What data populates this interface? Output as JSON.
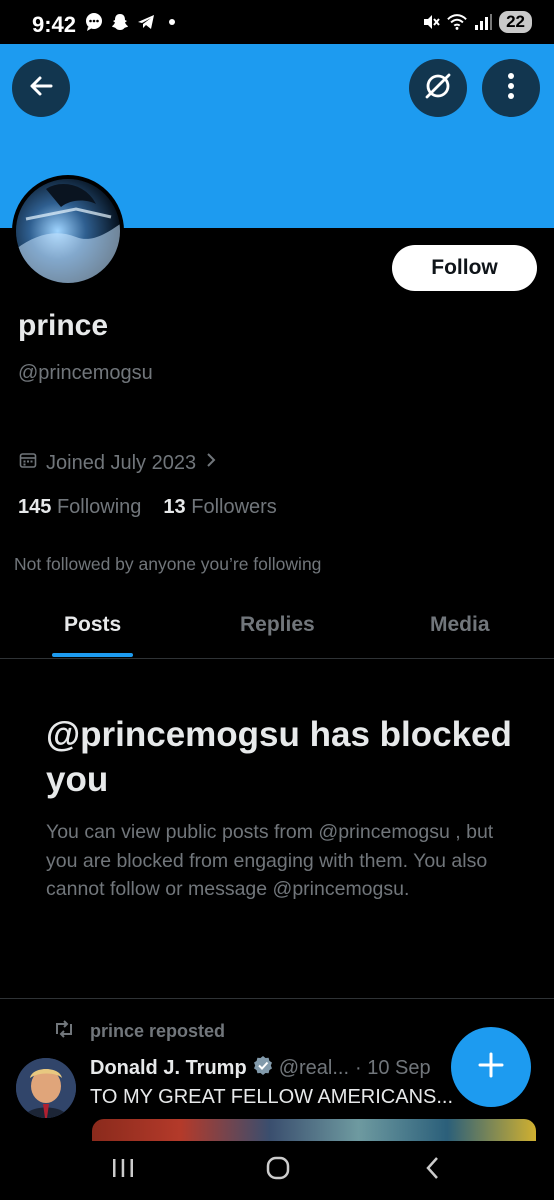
{
  "status_bar": {
    "time": "9:42",
    "battery": "22",
    "notification_icons": [
      "chat-bubble-icon",
      "snapchat-ghost-icon",
      "telegram-icon",
      "dot-icon"
    ],
    "system_icons": [
      "mute-icon",
      "wifi-icon",
      "signal-icon"
    ]
  },
  "profile": {
    "banner_color": "#1d9bf0",
    "name": "prince",
    "handle": "@princemogsu",
    "follow_label": "Follow",
    "joined": "Joined July 2023",
    "following_count": "145",
    "following_label": "Following",
    "followers_count": "13",
    "followers_label": "Followers",
    "not_followed": "Not followed by anyone you’re following"
  },
  "tabs": [
    {
      "label": "Posts",
      "active": true
    },
    {
      "label": "Replies",
      "active": false
    },
    {
      "label": "Media",
      "active": false
    }
  ],
  "blocked": {
    "title": "@princemogsu has blocked you",
    "body": "You can view public posts from @princemogsu , but you are blocked from engaging with them. You also cannot follow or message @princemogsu."
  },
  "post": {
    "repost_label": "prince reposted",
    "author_name": "Donald J. Trump",
    "author_handle": "@real...",
    "date": "· 10 Sep",
    "text": "TO MY GREAT FELLOW AMERICANS..."
  },
  "colors": {
    "accent": "#1d9bf0",
    "background": "#000000",
    "muted_text": "#71767b",
    "primary_text": "#e7e9ea",
    "divider": "#2f3336"
  }
}
